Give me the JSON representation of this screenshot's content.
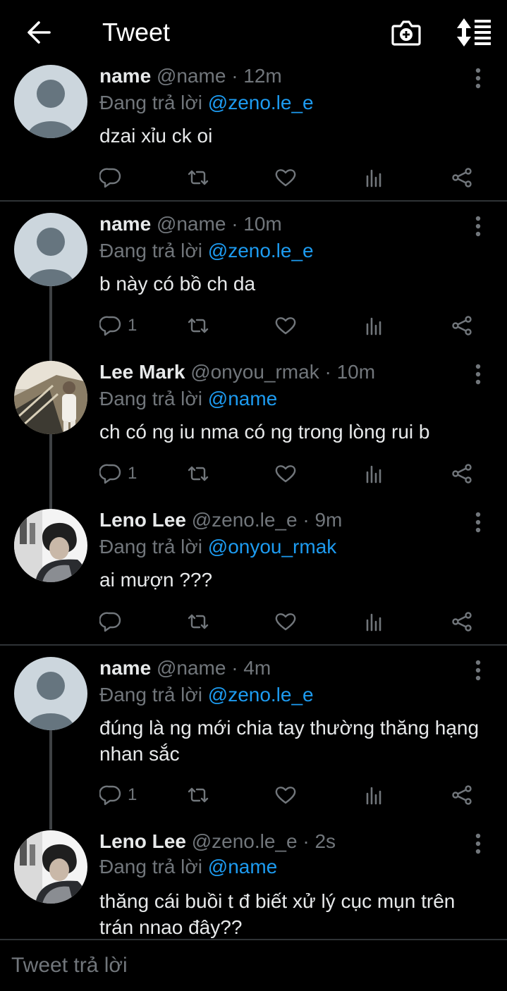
{
  "header": {
    "title": "Tweet",
    "back_icon": "arrow-left-icon",
    "camera_icon": "camera-plus-icon",
    "sort_icon": "sort-list-icon"
  },
  "reply_prefix": "Đang trả lời",
  "tweets": [
    {
      "name": "name",
      "handle": "@name",
      "time": "· 12m",
      "reply_to": "@zeno.le_e",
      "text": "dzai xỉu ck oi",
      "reply_count": "",
      "avatar": "default"
    },
    {
      "name": "name",
      "handle": "@name",
      "time": "· 10m",
      "reply_to": "@zeno.le_e",
      "text": "b này có bồ ch da",
      "reply_count": "1",
      "avatar": "default"
    },
    {
      "name": "Lee Mark",
      "handle": "@onyou_rmak",
      "time": "· 10m",
      "reply_to": "@name",
      "text": "ch có ng iu nma có ng trong lòng rui b",
      "reply_count": "1",
      "avatar": "photo-escalator"
    },
    {
      "name": "Leno Lee",
      "handle": "@zeno.le_e",
      "time": "· 9m",
      "reply_to": "@onyou_rmak",
      "text": "ai mượn ???",
      "reply_count": "",
      "avatar": "photo-portrait"
    },
    {
      "name": "name",
      "handle": "@name",
      "time": "· 4m",
      "reply_to": "@zeno.le_e",
      "text": "đúng là ng mới chia tay thường thăng hạng nhan sắc",
      "reply_count": "1",
      "avatar": "default"
    },
    {
      "name": "Leno Lee",
      "handle": "@zeno.le_e",
      "time": "· 2s",
      "reply_to": "@name",
      "text": "thăng cái buồi t đ biết xử lý cục mụn trên trán nnao đây??",
      "reply_count": "",
      "avatar": "photo-portrait"
    }
  ],
  "action_icons": [
    "reply-icon",
    "retweet-icon",
    "like-icon",
    "views-icon",
    "share-icon"
  ],
  "composer": {
    "placeholder": "Tweet trả lời"
  },
  "colors": {
    "background": "#000000",
    "accent": "#1d9bf0",
    "muted": "#71767b",
    "text": "#e7e9ea",
    "divider": "#2f3336"
  }
}
